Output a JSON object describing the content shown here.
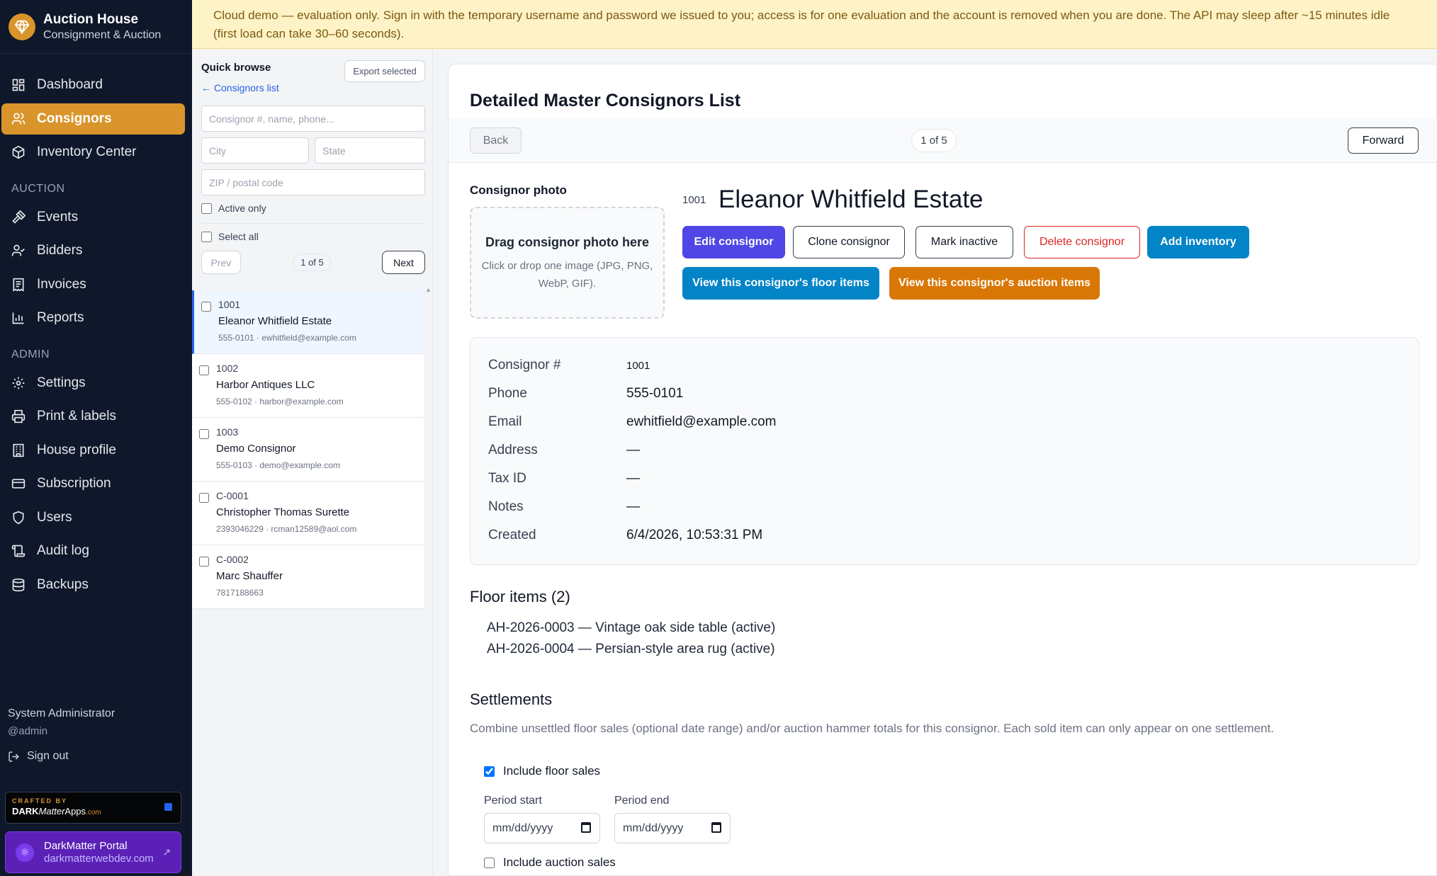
{
  "app": {
    "title": "Auction House",
    "subtitle": "Consignment & Auction"
  },
  "banner": "Cloud demo — evaluation only. Sign in with the temporary username and password we issued to you; access is for one evaluation and the account is removed when you are done. The API may sleep after ~15 minutes idle (first load can take 30–60 seconds).",
  "nav": {
    "dashboard": "Dashboard",
    "consignors": "Consignors",
    "inventory": "Inventory Center",
    "section_auction": "AUCTION",
    "events": "Events",
    "bidders": "Bidders",
    "invoices": "Invoices",
    "reports": "Reports",
    "section_admin": "ADMIN",
    "settings": "Settings",
    "print_labels": "Print & labels",
    "house_profile": "House profile",
    "subscription": "Subscription",
    "users": "Users",
    "audit_log": "Audit log",
    "backups": "Backups"
  },
  "user": {
    "name": "System Administrator",
    "handle": "@admin",
    "signout": "Sign out"
  },
  "crafted": {
    "top": "CRAFTED BY",
    "brand_bold": "DARK",
    "brand_italic": "Matter",
    "brand_rest": "Apps",
    "brand_small": ".com"
  },
  "portal": {
    "title": "DarkMatter Portal",
    "url": "darkmatterwebdev.com"
  },
  "browse": {
    "title": "Quick browse",
    "back_link": "← Consignors list",
    "export_label": "Export selected",
    "search_placeholder": "Consignor #, name, phone...",
    "city_placeholder": "City",
    "state_placeholder": "State",
    "zip_placeholder": "ZIP / postal code",
    "active_only": "Active only",
    "select_all": "Select all",
    "prev": "Prev",
    "page": "1 of 5",
    "next": "Next",
    "items": [
      {
        "num": "1001",
        "name": "Eleanor Whitfield Estate",
        "meta": "555-0101 · ewhitfield@example.com"
      },
      {
        "num": "1002",
        "name": "Harbor Antiques LLC",
        "meta": "555-0102 · harbor@example.com"
      },
      {
        "num": "1003",
        "name": "Demo Consignor",
        "meta": "555-0103 · demo@example.com"
      },
      {
        "num": "C-0001",
        "name": "Christopher Thomas Surette",
        "meta": "2393046229 · rcman12589@aol.com"
      },
      {
        "num": "C-0002",
        "name": "Marc Shauffer",
        "meta": "7817188663"
      }
    ]
  },
  "main": {
    "title": "Detailed Master Consignors List",
    "back": "Back",
    "count": "1 of 5",
    "forward": "Forward",
    "photo_label": "Consignor photo",
    "dropzone_title": "Drag consignor photo here",
    "dropzone_sub": "Click or drop one image (JPG, PNG, WebP, GIF).",
    "consignor_num": "1001",
    "consignor_name": "Eleanor Whitfield Estate",
    "actions": {
      "edit": "Edit consignor",
      "clone": "Clone consignor",
      "inactive": "Mark inactive",
      "delete": "Delete consignor",
      "add_inventory": "Add inventory",
      "floor_items": "View this consignor's floor items",
      "auction_items": "View this consignor's auction items"
    },
    "details": {
      "consignor_label": "Consignor #",
      "consignor_value": "1001",
      "phone_label": "Phone",
      "phone_value": "555-0101",
      "email_label": "Email",
      "email_value": "ewhitfield@example.com",
      "address_label": "Address",
      "address_value": "—",
      "taxid_label": "Tax ID",
      "taxid_value": "—",
      "notes_label": "Notes",
      "notes_value": "—",
      "created_label": "Created",
      "created_value": "6/4/2026, 10:53:31 PM"
    },
    "floor_heading": "Floor items (2)",
    "floor_items": [
      "AH-2026-0003 — Vintage oak side table (active)",
      "AH-2026-0004 — Persian-style area rug (active)"
    ],
    "settlements_heading": "Settlements",
    "settlements_desc": "Combine unsettled floor sales (optional date range) and/or auction hammer totals for this consignor. Each sold item can only appear on one settlement.",
    "include_floor": "Include floor sales",
    "period_start": "Period start",
    "period_end": "Period end",
    "date_placeholder": "mm/dd/yyyy",
    "include_auction": "Include auction sales"
  },
  "colors": {
    "accent": "#d9952b",
    "edit": "#4f46e5",
    "delete": "#dc2626",
    "blue": "#0284c7",
    "orange": "#d97706",
    "sidebar": "#0f172a"
  }
}
